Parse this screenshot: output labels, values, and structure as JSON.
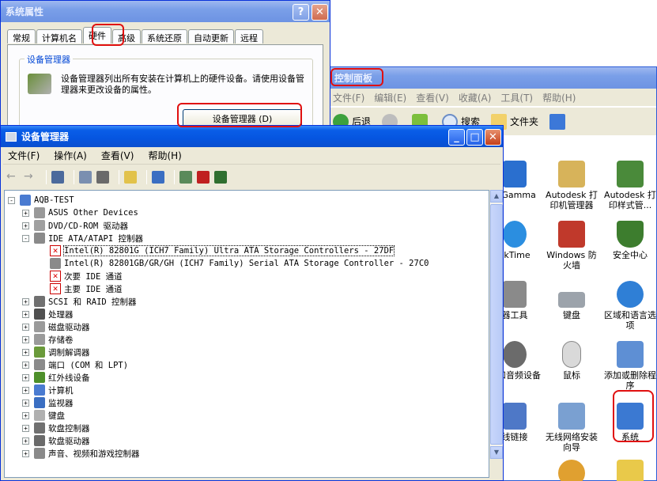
{
  "system_properties": {
    "title": "系统属性",
    "help_btn": "?",
    "close_btn": "✕",
    "tabs": [
      "常规",
      "计算机名",
      "硬件",
      "高级",
      "系统还原",
      "自动更新",
      "远程"
    ],
    "group_title": "设备管理器",
    "group_text": "设备管理器列出所有安装在计算机上的硬件设备。请使用设备管理器来更改设备的属性。",
    "device_manager_button": "设备管理器 (D)"
  },
  "control_panel": {
    "title": "控制面板",
    "menu": [
      "文件(F)",
      "编辑(E)",
      "查看(V)",
      "收藏(A)",
      "工具(T)",
      "帮助(H)"
    ],
    "toolbar": {
      "back": "后退",
      "search": "搜索",
      "folders": "文件夹"
    },
    "icons": [
      {
        "label": "e Gamma",
        "color": "#2a6fcf"
      },
      {
        "label": "Autodesk 打印机管理器",
        "color": "#d7b35a"
      },
      {
        "label": "Autodesk 打印样式管...",
        "color": "#4a8a3a"
      },
      {
        "label": "ckTime",
        "color": "#2b8ee0"
      },
      {
        "label": "Windows 防火墙",
        "color": "#c0392b"
      },
      {
        "label": "安全中心",
        "color": "#3d7d2e"
      },
      {
        "label": "器工具",
        "color": "#8a8a8a"
      },
      {
        "label": "键盘",
        "color": "#9ca3ab"
      },
      {
        "label": "区域和语言选项",
        "color": "#2f7fd6"
      },
      {
        "label": "音和音频设备",
        "color": "#6b6b6b"
      },
      {
        "label": "鼠标",
        "color": "#d9d9d9"
      },
      {
        "label": "添加或删除程序",
        "color": "#5e8fd4"
      },
      {
        "label": "线链接",
        "color": "#4e78c7"
      },
      {
        "label": "无线网络安装向导",
        "color": "#7aa0d1"
      },
      {
        "label": "系统",
        "color": "#3b79d2"
      }
    ]
  },
  "device_manager": {
    "title": "设备管理器",
    "menu": [
      "文件(F)",
      "操作(A)",
      "查看(V)",
      "帮助(H)"
    ],
    "tree": [
      {
        "label": "AQB-TEST",
        "level": 0,
        "expander": "-",
        "icon": "computer",
        "color": "#4a7bd1"
      },
      {
        "label": "ASUS Other Devices",
        "level": 1,
        "expander": "+",
        "icon": "device",
        "color": "#999999"
      },
      {
        "label": "DVD/CD-ROM 驱动器",
        "level": 1,
        "expander": "+",
        "icon": "cdrom",
        "color": "#a0a0a0"
      },
      {
        "label": "IDE ATA/ATAPI 控制器",
        "level": 1,
        "expander": "-",
        "icon": "ide",
        "color": "#8a8a8a"
      },
      {
        "label": "Intel(R) 82801G (ICH7 Family) Ultra ATA Storage Controllers - 27DF",
        "level": 2,
        "error": true,
        "selected": true
      },
      {
        "label": "Intel(R) 82801GB/GR/GH (ICH7 Family) Serial ATA Storage Controller - 27C0",
        "level": 2,
        "icon": "ide",
        "color": "#8a8a8a"
      },
      {
        "label": "次要 IDE 通道",
        "level": 2,
        "error": true
      },
      {
        "label": "主要 IDE 通道",
        "level": 2,
        "error": true
      },
      {
        "label": "SCSI 和 RAID 控制器",
        "level": 1,
        "expander": "+",
        "icon": "scsi",
        "color": "#707070"
      },
      {
        "label": "处理器",
        "level": 1,
        "expander": "+",
        "icon": "cpu",
        "color": "#505050"
      },
      {
        "label": "磁盘驱动器",
        "level": 1,
        "expander": "+",
        "icon": "disk",
        "color": "#9a9a9a"
      },
      {
        "label": "存储卷",
        "level": 1,
        "expander": "+",
        "icon": "volume",
        "color": "#9a9a9a"
      },
      {
        "label": "调制解调器",
        "level": 1,
        "expander": "+",
        "icon": "modem",
        "color": "#6a9a3a"
      },
      {
        "label": "端口 (COM 和 LPT)",
        "level": 1,
        "expander": "+",
        "icon": "port",
        "color": "#8a8a8a"
      },
      {
        "label": "红外线设备",
        "level": 1,
        "expander": "+",
        "icon": "ir",
        "color": "#4d8f2a"
      },
      {
        "label": "计算机",
        "level": 1,
        "expander": "+",
        "icon": "computer",
        "color": "#4a7bd1"
      },
      {
        "label": "监视器",
        "level": 1,
        "expander": "+",
        "icon": "monitor",
        "color": "#3a6ec2"
      },
      {
        "label": "键盘",
        "level": 1,
        "expander": "+",
        "icon": "keyboard",
        "color": "#b0b0b0"
      },
      {
        "label": "软盘控制器",
        "level": 1,
        "expander": "+",
        "icon": "floppyctl",
        "color": "#707070"
      },
      {
        "label": "软盘驱动器",
        "level": 1,
        "expander": "+",
        "icon": "floppy",
        "color": "#6a6a6a"
      },
      {
        "label": "声音、视频和游戏控制器",
        "level": 1,
        "expander": "+",
        "icon": "sound",
        "color": "#8a8a8a"
      }
    ]
  }
}
